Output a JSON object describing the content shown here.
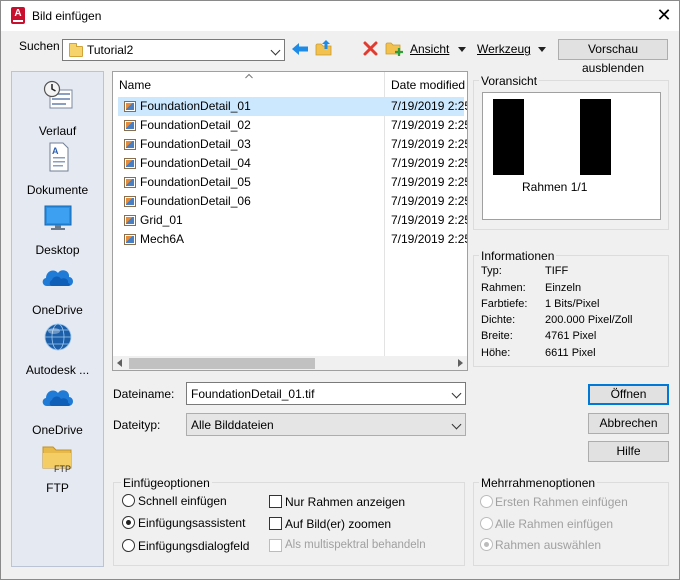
{
  "window": {
    "title": "Bild einfügen",
    "app_icon_letter": "A"
  },
  "toolbar": {
    "look_in_label": "Suchen in:",
    "look_in_value": "Tutorial2",
    "view_label": "Ansicht",
    "tools_label": "Werkzeug",
    "hide_preview_label": "Vorschau ausblenden"
  },
  "places": [
    {
      "label": "Verlauf",
      "icon": "history-icon"
    },
    {
      "label": "Dokumente",
      "icon": "documents-icon"
    },
    {
      "label": "Desktop",
      "icon": "desktop-icon"
    },
    {
      "label": "OneDrive",
      "icon": "onedrive-icon"
    },
    {
      "label": "Autodesk ...",
      "icon": "autodesk-globe-icon"
    },
    {
      "label": "OneDrive",
      "icon": "onedrive-icon"
    },
    {
      "label": "FTP",
      "icon": "ftp-folder-icon"
    }
  ],
  "filelist": {
    "col_name": "Name",
    "col_date": "Date modified",
    "files": [
      {
        "name": "FoundationDetail_01",
        "date": "7/19/2019 2:25"
      },
      {
        "name": "FoundationDetail_02",
        "date": "7/19/2019 2:25"
      },
      {
        "name": "FoundationDetail_03",
        "date": "7/19/2019 2:25"
      },
      {
        "name": "FoundationDetail_04",
        "date": "7/19/2019 2:25"
      },
      {
        "name": "FoundationDetail_05",
        "date": "7/19/2019 2:25"
      },
      {
        "name": "FoundationDetail_06",
        "date": "7/19/2019 2:25"
      },
      {
        "name": "Grid_01",
        "date": "7/19/2019 2:25"
      },
      {
        "name": "Mech6A",
        "date": "7/19/2019 2:25"
      }
    ]
  },
  "preview": {
    "label": "Voransicht",
    "caption": "Rahmen 1/1"
  },
  "info": {
    "label": "Informationen",
    "rows": [
      {
        "key": "Typ:",
        "value": "TIFF"
      },
      {
        "key": "Rahmen:",
        "value": "Einzeln"
      },
      {
        "key": "Farbtiefe:",
        "value": "1 Bits/Pixel"
      },
      {
        "key": "Dichte:",
        "value": "200.000 Pixel/Zoll"
      },
      {
        "key": "Breite:",
        "value": "4761 Pixel"
      },
      {
        "key": "Höhe:",
        "value": "6611 Pixel"
      }
    ]
  },
  "filename": {
    "label": "Dateiname:",
    "value": "FoundationDetail_01.tif"
  },
  "filetype": {
    "label": "Dateityp:",
    "value": "Alle Bilddateien"
  },
  "buttons": {
    "open": "Öffnen",
    "cancel": "Abbrechen",
    "help": "Hilfe"
  },
  "insert_options": {
    "label": "Einfügeoptionen",
    "radios": [
      {
        "label": "Schnell einfügen",
        "checked": false
      },
      {
        "label": "Einfügungsassistent",
        "checked": true
      },
      {
        "label": "Einfügungsdialogfeld",
        "checked": false
      }
    ],
    "checks": [
      {
        "label": "Nur Rahmen anzeigen",
        "checked": false,
        "enabled": true
      },
      {
        "label": "Auf Bild(er) zoomen",
        "checked": false,
        "enabled": true
      },
      {
        "label": "Als multispektral behandeln",
        "checked": false,
        "enabled": false
      }
    ]
  },
  "multiframe_options": {
    "label": "Mehrrahmenoptionen",
    "radios": [
      {
        "label": "Ersten Rahmen einfügen",
        "checked": false
      },
      {
        "label": "Alle Rahmen einfügen",
        "checked": false
      },
      {
        "label": "Rahmen auswählen",
        "checked": true
      }
    ]
  },
  "colors": {
    "accent": "#0078d7",
    "selection": "#cce8ff",
    "places_bg": "#e5e9f1"
  }
}
